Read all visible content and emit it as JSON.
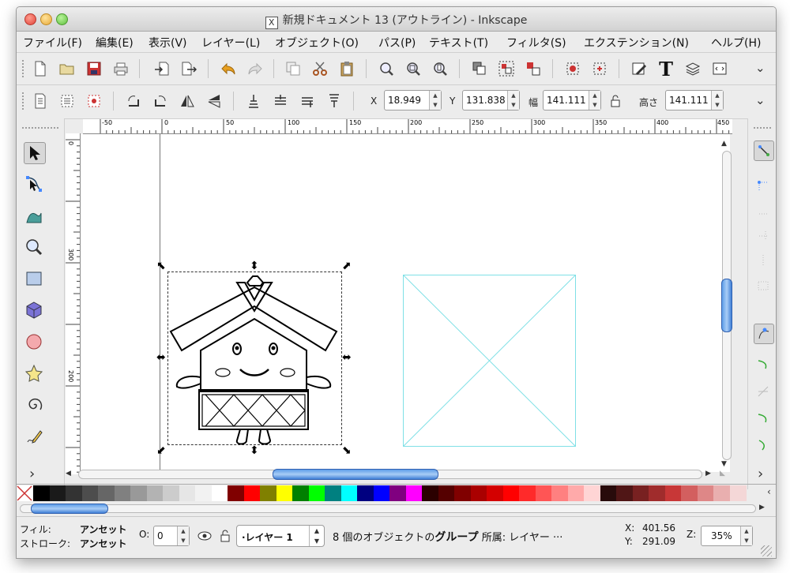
{
  "window": {
    "title": "新規ドキュメント 13 (アウトライン) - Inkscape",
    "title_icon": "X"
  },
  "menu": [
    "ファイル(F)",
    "編集(E)",
    "表示(V)",
    "レイヤー(L)",
    "オブジェクト(O)",
    "パス(P)",
    "テキスト(T)",
    "フィルタ(S)",
    "エクステンション(N)",
    "ヘルプ(H)"
  ],
  "commands_toolbar": {
    "icons": [
      "new-document-icon",
      "open-icon",
      "save-icon",
      "print-icon",
      "import-icon",
      "export-icon",
      "undo-icon",
      "redo-icon",
      "duplicate-icon",
      "cut-icon",
      "paste-icon",
      "zoom-selection-icon",
      "zoom-drawing-icon",
      "zoom-page-icon",
      "raise-top-icon",
      "group-icon",
      "ungroup-icon",
      "fill-stroke-icon",
      "xml-editor-icon",
      "text-icon",
      "layers-icon",
      "document-props-icon"
    ],
    "overflow_glyph": "⌄"
  },
  "controls_toolbar": {
    "x_label": "X",
    "x_value": "18.949",
    "y_label": "Y",
    "y_value": "131.838",
    "w_label": "幅",
    "w_value": "141.111",
    "h_label": "高さ",
    "h_value": "141.111",
    "overflow_glyph": "⌄"
  },
  "ruler": {
    "h_ticks": [
      "-50",
      "0",
      "50",
      "100",
      "150",
      "200",
      "250",
      "300",
      "350",
      "400",
      "450"
    ],
    "v_ticks": [
      "0",
      "300",
      "200"
    ]
  },
  "toolbox": {
    "tools": [
      "selector-tool-icon",
      "node-tool-icon",
      "tweak-tool-icon",
      "zoom-tool-icon",
      "rectangle-tool-icon",
      "3d-box-tool-icon",
      "ellipse-tool-icon",
      "star-tool-icon",
      "spiral-tool-icon",
      "pencil-tool-icon"
    ],
    "more_glyph": "›"
  },
  "snap_toolbar": {
    "more_glyph": "›"
  },
  "palette": {
    "colors": [
      "#000000",
      "#1a1a1a",
      "#333333",
      "#4d4d4d",
      "#666666",
      "#808080",
      "#999999",
      "#b3b3b3",
      "#cccccc",
      "#e6e6e6",
      "#f2f2f2",
      "#ffffff",
      "#800000",
      "#ff0000",
      "#808000",
      "#ffff00",
      "#008000",
      "#00ff00",
      "#008080",
      "#00ffff",
      "#000080",
      "#0000ff",
      "#800080",
      "#ff00ff",
      "#2b0000",
      "#550000",
      "#800000",
      "#aa0000",
      "#d40000",
      "#ff0000",
      "#ff2a2a",
      "#ff5555",
      "#ff8080",
      "#ffaaaa",
      "#ffd5d5",
      "#280b0b",
      "#501616",
      "#782121",
      "#a02c2c",
      "#c83737",
      "#d35f5f",
      "#de8787",
      "#e9afaf",
      "#f4d7d7"
    ]
  },
  "status": {
    "fill_label": "フィル:",
    "fill_value": "アンセット",
    "stroke_label": "ストローク:",
    "stroke_value": "アンセット",
    "opacity_label": "O:",
    "opacity_value": "0",
    "layer_value": "·レイヤー 1",
    "message_prefix": "8 個のオブジェクトの",
    "message_bold": "グループ",
    "message_suffix": " 所属: レイヤー ···",
    "cursor_x_label": "X:",
    "cursor_x": "401.56",
    "cursor_y_label": "Y:",
    "cursor_y": "291.09",
    "zoom_label": "Z:",
    "zoom_value": "35%"
  }
}
